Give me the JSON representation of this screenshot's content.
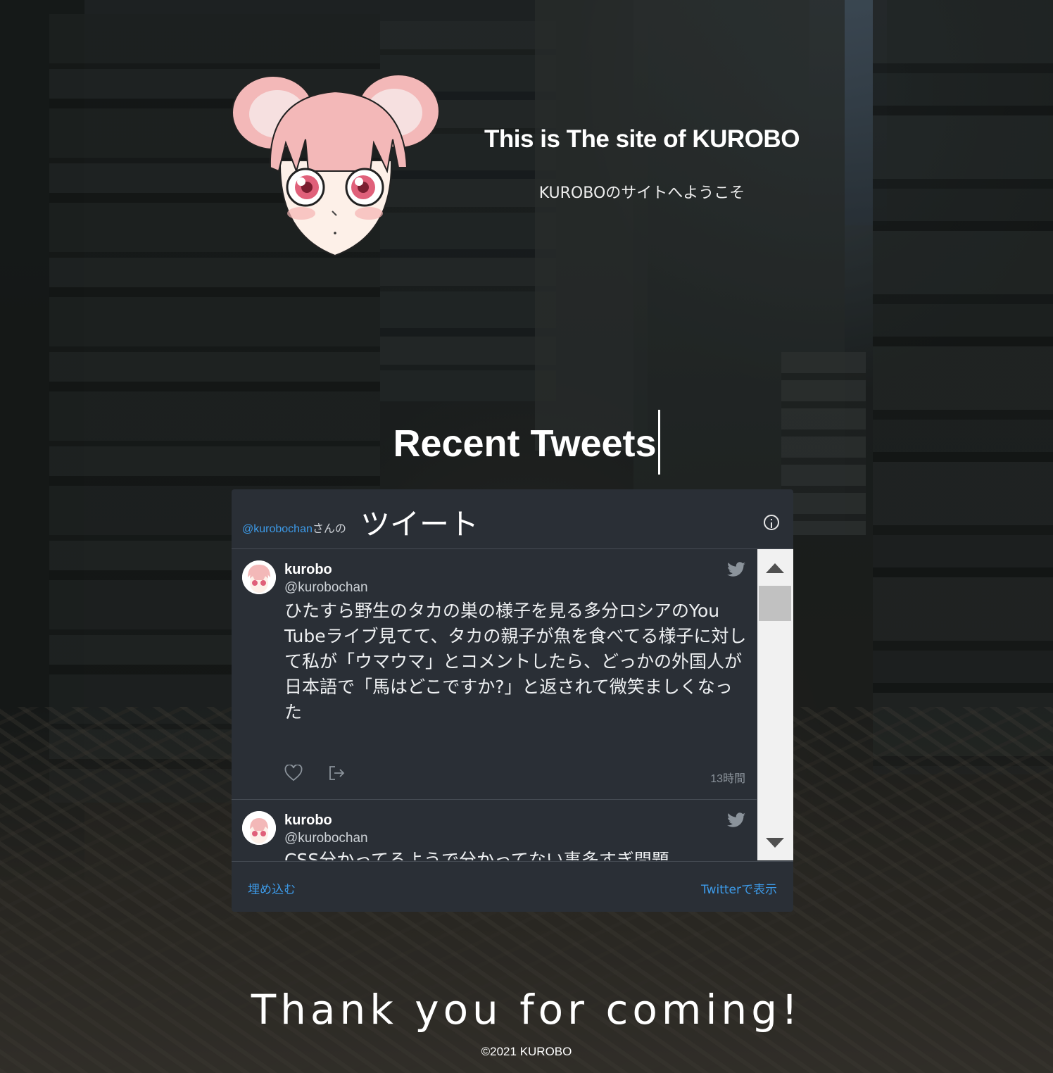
{
  "header": {
    "title": "This is The site of KUROBO",
    "subtitle": "KUROBOのサイトへようこそ"
  },
  "section_heading": "Recent Tweets",
  "twitter_widget": {
    "handle": "@kurobochan",
    "handle_suffix": "さんの",
    "title_word": "ツイート",
    "tweets": [
      {
        "name": "kurobo",
        "handle": "@kurobochan",
        "text": "ひたすら野生のタカの巣の様子を見る多分ロシアのYou Tubeライブ見てて、タカの親子が魚を食べてる様子に対して私が「ウマウマ」とコメントしたら、どっかの外国人が日本語で「馬はどこですか?」と返されて微笑ましくなった",
        "time": "13時間"
      },
      {
        "name": "kurobo",
        "handle": "@kurobochan",
        "text": "CSS分かってるようで分かってない事多すぎ問題"
      }
    ],
    "footer_embed": "埋め込む",
    "footer_view": "Twitterで表示"
  },
  "footer": {
    "thanks": "Thank you for coming!",
    "copyright": "©2021 KUROBO"
  },
  "colors": {
    "link": "#3d9be9",
    "widget_bg": "#2a2f36",
    "hair_pink": "#f3b8b8"
  },
  "icons": [
    "info-icon",
    "twitter-bird-icon",
    "heart-icon",
    "share-icon",
    "scroll-up-arrow",
    "scroll-down-arrow"
  ]
}
